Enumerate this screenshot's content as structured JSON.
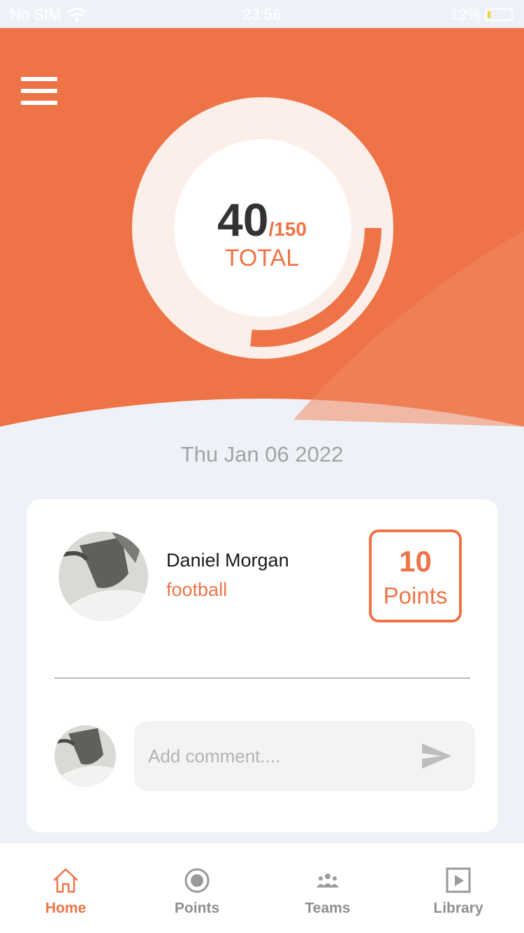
{
  "status_bar": {
    "carrier": "No SIM",
    "time": "23:56",
    "battery": "12%",
    "battery_level": 0.12
  },
  "hero": {
    "menu_icon": "hamburger-menu-icon",
    "score": "40",
    "score_max": "/150",
    "score_label": "TOTAL",
    "progress": 0.2667
  },
  "date": "Thu Jan 06 2022",
  "post": {
    "user_name": "Daniel Morgan",
    "sport": "football",
    "points_value": "10",
    "points_label": "Points"
  },
  "comment": {
    "placeholder": "Add comment....",
    "send_icon": "send-icon"
  },
  "tabs": [
    {
      "label": "Home",
      "icon": "home-icon",
      "active": true
    },
    {
      "label": "Points",
      "icon": "target-icon",
      "active": false
    },
    {
      "label": "Teams",
      "icon": "teams-icon",
      "active": false
    },
    {
      "label": "Library",
      "icon": "play-square-icon",
      "active": false
    }
  ],
  "colors": {
    "accent": "#ee7447",
    "background": "#eef2f8",
    "ring_track": "#fceee8"
  }
}
